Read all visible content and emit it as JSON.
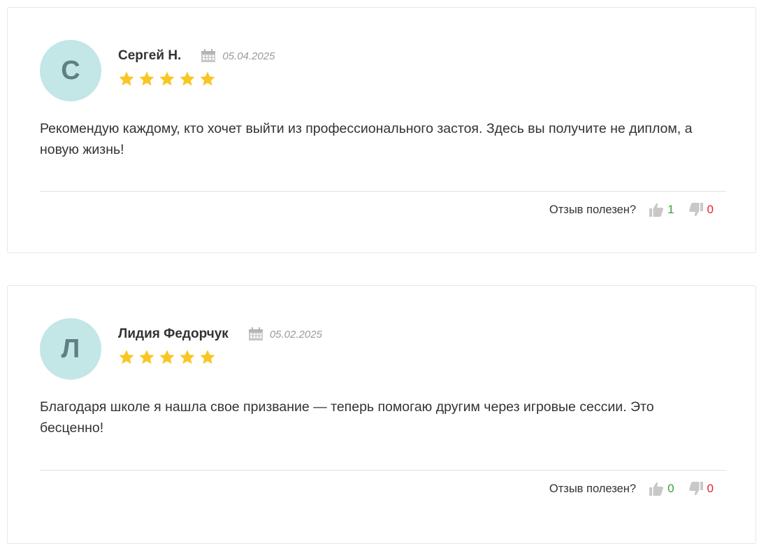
{
  "reviews": [
    {
      "avatar_letter": "С",
      "author": "Сергей Н.",
      "date": "05.04.2025",
      "rating": 5,
      "text": "Рекомендую каждому, кто хочет выйти из профессионального застоя. Здесь вы получите не диплом, а новую жизнь!",
      "helpful_label": "Отзыв полезен?",
      "likes": "1",
      "dislikes": "0"
    },
    {
      "avatar_letter": "Л",
      "author": "Лидия Федорчук",
      "date": "05.02.2025",
      "rating": 5,
      "text": "Благодаря школе я нашла свое призвание — теперь помогаю другим через игровые сессии. Это бесценно!",
      "helpful_label": "Отзыв полезен?",
      "likes": "0",
      "dislikes": "0"
    }
  ],
  "colors": {
    "avatar_bg": "#c3e6e7",
    "avatar_text": "#5f7f83",
    "star": "#f9c623",
    "like_count": "#3aa336",
    "dislike_count": "#e0242c",
    "icon_gray": "#c8c8c8"
  },
  "icons": {
    "date": "calendar-icon",
    "rating": "star-icon",
    "like": "thumbs-up-icon",
    "dislike": "thumbs-down-icon"
  }
}
